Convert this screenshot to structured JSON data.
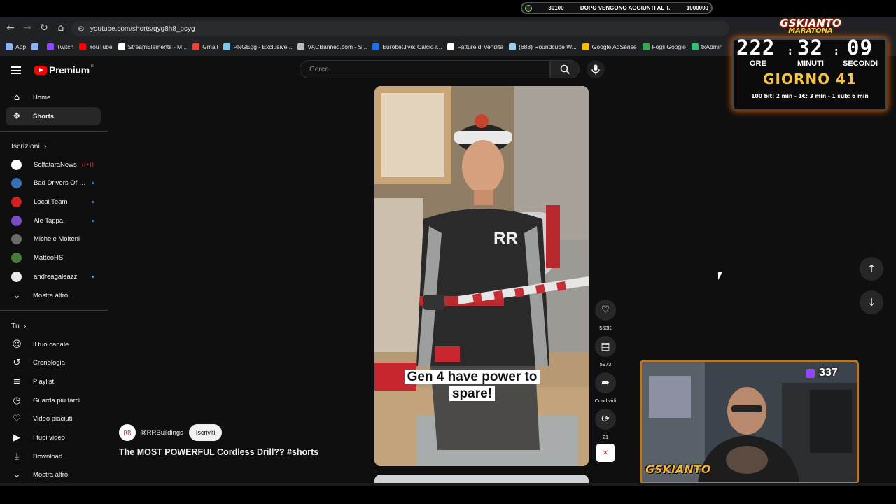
{
  "stream_ticker": {
    "start": "30100",
    "message": "DOPO VENGONO AGGIUNTI AL T.",
    "goal": "1000000"
  },
  "browser": {
    "url": "youtube.com/shorts/qyg8h8_pcyg"
  },
  "bookmarks": [
    {
      "label": "App",
      "color": "#8ab4f8"
    },
    {
      "label": "",
      "color": "#8ab4f8"
    },
    {
      "label": "Twitch",
      "color": "#9147ff"
    },
    {
      "label": "YouTube",
      "color": "#ff0000"
    },
    {
      "label": "StreamElements - M...",
      "color": "#ffffff"
    },
    {
      "label": "Gmail",
      "color": "#ea4335"
    },
    {
      "label": "PNGEgg - Exclusive...",
      "color": "#7cc7f0"
    },
    {
      "label": "VACBanned.com - S...",
      "color": "#bbbbbb"
    },
    {
      "label": "Eurobet.live: Calcio r...",
      "color": "#1a73e8"
    },
    {
      "label": "Fatture di vendita",
      "color": "#ffffff"
    },
    {
      "label": "(688) Roundcube W...",
      "color": "#9ad0f0"
    },
    {
      "label": "Google AdSense",
      "color": "#fbbc04"
    },
    {
      "label": "Fogli Google",
      "color": "#34a853"
    },
    {
      "label": "txAdmin",
      "color": "#2fbf71"
    }
  ],
  "header": {
    "brand": "Premium",
    "region": "IT",
    "search_placeholder": "Cerca"
  },
  "sidebar": {
    "main": [
      {
        "label": "Home",
        "icon": "home-icon",
        "glyph": "⌂"
      },
      {
        "label": "Shorts",
        "icon": "shorts-icon",
        "glyph": "❖"
      }
    ],
    "subscriptions_title": "Iscrizioni",
    "subscriptions": [
      {
        "label": "SolfataraNews",
        "color": "#ffffff",
        "badge": "live"
      },
      {
        "label": "Bad Drivers Of It...",
        "color": "#3a6fb5",
        "badge": "new"
      },
      {
        "label": "Local Team",
        "color": "#d2201f",
        "badge": "new"
      },
      {
        "label": "Ale Tappa",
        "color": "#7a4cc2",
        "badge": "new"
      },
      {
        "label": "Michele Molteni",
        "color": "#6b6b6b",
        "badge": ""
      },
      {
        "label": "MatteoHS",
        "color": "#4a7a3a",
        "badge": ""
      },
      {
        "label": "andreagaleazzi",
        "color": "#e8e8e8",
        "badge": "new"
      }
    ],
    "show_more": "Mostra altro",
    "you_title": "Tu",
    "you": [
      {
        "label": "Il tuo canale",
        "icon": "channel-icon",
        "glyph": "☺"
      },
      {
        "label": "Cronologia",
        "icon": "history-icon",
        "glyph": "↺"
      },
      {
        "label": "Playlist",
        "icon": "playlist-icon",
        "glyph": "≡"
      },
      {
        "label": "Guarda più tardi",
        "icon": "clock-icon",
        "glyph": "◷"
      },
      {
        "label": "Video piaciuti",
        "icon": "thumbs-up-icon",
        "glyph": "♡"
      },
      {
        "label": "I tuoi video",
        "icon": "your-videos-icon",
        "glyph": "▶"
      },
      {
        "label": "Download",
        "icon": "download-icon",
        "glyph": "⤓"
      },
      {
        "label": "Mostra altro",
        "icon": "chevron-down-icon",
        "glyph": "⌄"
      }
    ]
  },
  "short": {
    "caption": "Gen 4 have power to spare!",
    "channel": "@RRBuildings",
    "subscribe_label": "Iscriviti",
    "title": "The MOST POWERFUL Cordless Drill?? #shorts",
    "likes": "563K",
    "comments": "5973",
    "share_label": "Condividi",
    "remix": "21"
  },
  "stream_overlay": {
    "title": "GSKIANTO",
    "subtitle": "MARATONA",
    "hours": "222",
    "minutes": "32",
    "seconds": "09",
    "hours_label": "ORE",
    "minutes_label": "MINUTI",
    "seconds_label": "SECONDI",
    "day": "GIORNO 41",
    "rules": "100 bit: 2 min - 1€: 3 min - 1 sub: 6 min",
    "viewers": "337",
    "cam_logo": "GSKIANTO"
  },
  "colors": {
    "accent": "#ff0000",
    "overlay_gold": "#f5c242",
    "twitch": "#9147ff"
  }
}
